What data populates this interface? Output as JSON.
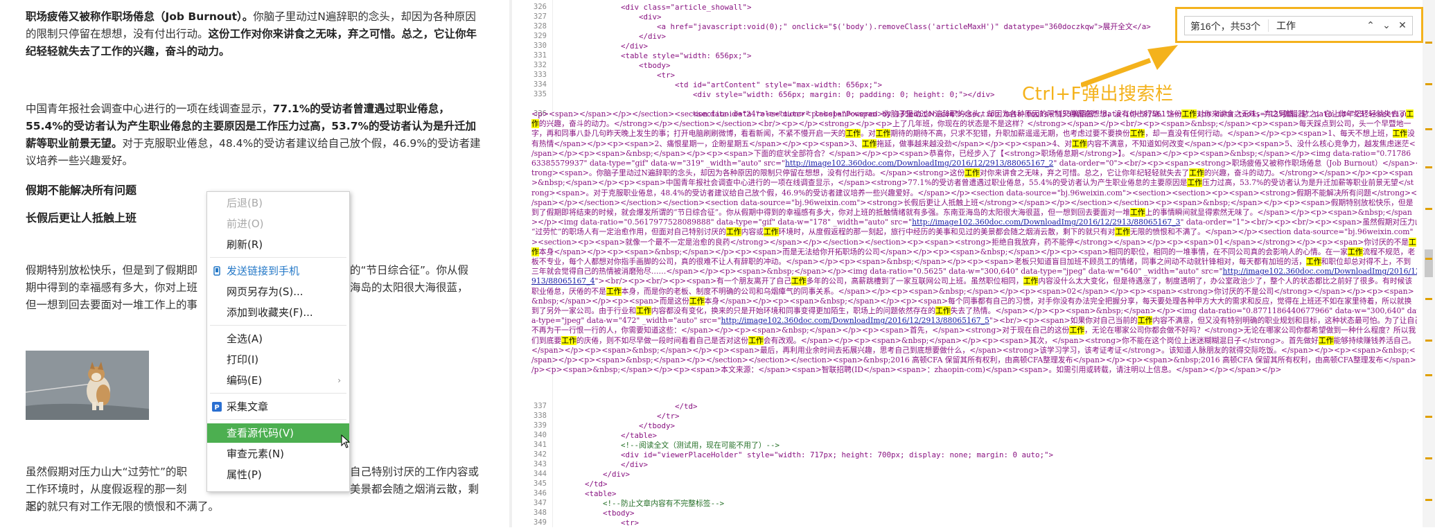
{
  "article": {
    "p1_a": "职场疲倦又被称作职场倦怠（Job Burnout）。",
    "p1_b": "你脑子里动过N遍辞职的念头，却因为各种原因的限制只停留在想想，没有付出行动。",
    "p1_c": "这份工作对你来讲食之无味，弃之可惜。总之，它让你年纪轻轻就失去了工作的兴趣，奋斗的动力。",
    "p2_a": "中国青年报社会调查中心进行的一项在线调查显示，",
    "p2_b": "77.1%的受访者曾遭遇过职业倦怠，55.4%的受访者认为产生职业倦怠的主要原因是工作压力过高，53.7%的受访者认为是升迁加薪等职业前景无望。",
    "p2_c": "对于克服职业倦怠，48.4%的受访者建议给自己放个假，46.9%的受访者建议培养一些兴趣爱好。",
    "heading1": "假期不能解决所有问题",
    "heading2": "长假后更让人抵触上班",
    "p3_line1_a": "假期特别放松快乐，但是到了假期即",
    "p3_line1_b": "的“节日综合征”。你从假",
    "p3_line2_a": "期中得到的幸福感有多大，你对上班",
    "p3_line2_b": "海岛的太阳很大海很蓝，",
    "p3_line3_a": "但一想到回去要面对一堆工作上的事",
    "p4_line1_a": "虽然假期对压力山大“过劳忙”的职",
    "p4_line1_b": "自己特别讨厌的工作内容或",
    "p4_line2_a": "工作环境时，从度假返程的那一刻起，",
    "p4_line2_b": "美景都会随之烟消云散，剩",
    "p4_line3": "下的就只有对工作无限的愤恨和不满了。"
  },
  "context_menu": {
    "back": "后退(B)",
    "forward": "前进(O)",
    "refresh": "刷新(R)",
    "send_to_phone": "发送链接到手机",
    "save_as": "网页另存为(S)...",
    "add_favorite": "添加到收藏夹(F)...",
    "select_all": "全选(A)",
    "print": "打印(I)",
    "encoding": "编码(E)",
    "collect_article": "采集文章",
    "view_source": "查看源代码(V)",
    "inspect": "审查元素(N)",
    "properties": "属性(P)"
  },
  "find_bar": {
    "match_count": "第16个，共53个",
    "query": "工作"
  },
  "annotation": "Ctrl+F弹出搜索栏",
  "source": {
    "line_numbers_top": [
      "326",
      "327",
      "328",
      "329",
      "330",
      "331",
      "332",
      "333",
      "334",
      "335",
      "336"
    ],
    "line_numbers_bottom": [
      "337",
      "338",
      "339",
      "340",
      "341",
      "342",
      "343",
      "344",
      "345",
      "346",
      "347",
      "348",
      "349"
    ],
    "l326": "<div class=\"article_showall\">",
    "l327": "<div>",
    "l328": "<a href=\"javascript:void(0);\" onclick=\"$('body').removeClass('articleMaxH')\" datatype=\"360doczkqw\">展开全文</a>",
    "l329": "</div>",
    "l330": "</div>",
    "l331": "<table style=\"width: 656px;\">",
    "l332": "<tbody>",
    "l333": "<tr>",
    "l334": "<td id=\"artContent\" style=\"max-width: 656px;\">",
    "l335": "<div style=\"width: 656px; margin: 0; padding: 0; height: 0;\"></div>",
    "l336": "<section data-role=\"outer\" label=\"Powered by 135editor.com\"><section data-tools=\"135编辑器\" data-id=\"87561\"><section data-tools=\"135编辑器\" data-id=\"23\"><section",
    "l337": "</td>",
    "l338": "</tr>",
    "l339": "</tbody>",
    "l340": "</table>",
    "l341": "<!--阅读全文（测试用，现在可能不用了）-->",
    "l342": "<div id=\"viewerPlaceHolder\" style=\"width: 717px; height: 700px; display: none; margin: 0 auto;\">",
    "l343": "</div>",
    "l344": "</div>",
    "l345": "</td>",
    "l346": "<table>",
    "l347": "<!--防止文章内容有不完整标签-->",
    "l348": "<tbody>",
    "l349": "<tr>",
    "blob": [
      "<p><span></span></p></section><section data-id=\"24\"><section><p><span><span>你脑子里动过N遍辞职的念头，却因为各种原因的限制只停留在想想，没有付出行动。这份",
      "工作",
      "对你来讲食之无味，弃之可惜。总之，它让你年纪轻轻就失去了",
      "工作",
      "的兴趣，奋斗的动力。</strong></p></section></section><br/><p></p><strong></p><p>上了几年班，你现在的状态是不是这样？</strong></span></p><br/><p><span>&nbsp;</span><p><span>每天踩点到公司，头一个早暨地一字，再和同事八卦几句昨天晚上发生的事；打开电脑刷刷微博，看看新闻，不紧不慢开启一天的",
      "工作",
      "。对",
      "工作",
      "期待的期待不高，只求不犯错，升职加薪遥遥无期，也考虑过要不要换份",
      "工作",
      "，却一直没有任何行动。</span></p><p><span>1、每天不想上班，",
      "工作",
      "没有热情</span></p><p><span>2、痛恨星期一，企盼星期五</span></p><p><span>3、",
      "工作",
      "拖延，做事越来越没劲</span></p><p><span>4、对",
      "工作",
      "内容不满意，不知道如何改变</span></p><p><span>5、没什么核心竞争力，越发焦虑迷茫</span></p><p><span>&nbsp;</span></p><p><span>下面的症状全部符合？</span></p><p><span>恭喜你，已经步入了【<strong>职场倦怠期</strong>】。</span></p><p><span>&nbsp;</span></p><img data-ratio=\"0.7178663385579937\" data-type=\"gif\" data-w=\"319\" _width=\"auto\" src=\"",
      "http://image102.360doc.com/DownloadImg/2016/12/2913/88065167_2",
      "\" data-order=\"0\"><br/><p><span><strong>职场疲倦又被称作职场倦怠（Job Burnout）</span></strong><span>。你脑子里动过N遍辞职的念头，却因为各种原因的限制只停留在想想，没有付出行动。</span><strong>这份",
      "工作",
      "对你来讲食之无味，弃之可惜。总之，它让你年纪轻轻就失去了",
      "工作",
      "的兴趣，奋斗的动力。</strong></span></p><p><span>&nbsp;</span></p><p><span>中国青年报社会调查中心进行的一项在线调查显示，</span><strong>77.1%的受访者曾遭遇过职业倦怠，55.4%的受访者认为产生职业倦怠的主要原因是",
      "工作",
      "压力过高，53.7%的受访者认为是升迁加薪等职业前景无望</strong><span>。对于克服职业倦怠，48.4%的受访者建议给自己放个假，46.9%的受访者建议培养一些兴趣爱好。</span></p><section data-source=\"bj.96weixin.com\"><section><section><p><span><strong>假期不能解决所有问题</strong></span></p></section></section></section><section data-source=\"bj.96weixin.com\"><strong>长假后更让人抵触上班</strong></span></p></section></section><p><span>&nbsp;</span></p><p><span>假期特别放松快乐，但是到了假期即将结束的时候，就会爆发所谓的“节日综合征”。你从假期中得到的幸福感有多大，你对上班的抵触情绪就有多强。东南亚海岛的太阳很大海很蓝，但一想到回去要面对一堆",
      "工作",
      "上的事情瞬间就显得索然无味了。</span></p><p><span>&nbsp;</span></p><img data-ratio=\"0.5617977528089888\" data-type=\"gif\" data-w=\"178\" _width=\"auto\" src=\"",
      "http://image102.360doc.com/DownloadImg/2016/12/2913/88065167_3",
      "\" data-order=\"1\"><br/><p><br/><p><span>虽然假期对压力山大“过劳忙”的职场人有一定治愈作用，但面对自己特别讨厌的",
      "工作",
      "内容或",
      "工作",
      "环境时，从度假返程的那一刻起，旅行中经历的美事和见过的美景都会随之烟消云散，剩下的就只有对",
      "工作",
      "无限的愤恨和不满了。</span></p><section data-source=\"bj.96weixin.com\"><section><p><span>就像一个最不一定是治愈的良药</strong></span></p></section></section><p><span><strong>拒绝自我放弃，药不能停</strong></span></p><p><span>01</span></strong></p><p><span>你讨厌的不是",
      "工作",
      "本身</span></p><p><span>&nbsp;</span></p><p><span>而是无法给你开拓职场的公司</span></p><p><span>&nbsp;</span></p><p><span>相同的职位，相同的一堆事情，在不同公司真的会影响人的心情。在一家",
      "工作",
      "流程不规范，老板不专业，每个人都想对你指手画脚的公司，真的很难不让人有辞职的冲动。</span></p><p><span>&nbsp;</span></p><p><span>老板只知道盲目加班不顾员工的情绪，同事之间动不动就针锋相对，每天都有加班的活，",
      "工作",
      "和职位却总对得不上，不到三年就会觉得自己的热情被消磨殆尽……</span></p><p><span>&nbsp;</span></p><img data-ratio=\"0.5625\" data-w=\"300,640\" data-type=\"jpeg\" data-w=\"640\" _width=\"auto\" src=\"",
      "http://image102.360doc.com/DownloadImg/2016/12/2913/88065167_4",
      "\"><br/><p><br/><p><span>有一个朋友离开了自己",
      "工作",
      "多年的公司，高薪跳槽到了一家互联网公司上班。虽然职位相同，",
      "工作",
      "内容没什么太大变化，但是待遇涨了，制度透明了，办公室政治少了，整个人的状态都比之前好了很多。有时候该职业倦怠，厌倦的不是",
      "工作",
      "本身，而是你的老板、制度不明确的公司和乌烟瘴气的同事关系。</span></p><p><span>&nbsp;</span></p><p><span>02</span></p><p><span><strong>你讨厌的不是公司</strong></span></p><p><span>&nbsp;</span></p><p><span>而是这份",
      "工作",
      "本身</span></p><p><span>&nbsp;</span></p><p><span>每个同事都有自己的习惯，对手你没有办法完全把握分享，每天要处理各种甲方大大的需求和反应，觉得在上班还不如在家里待着，所以就换到了另外一家公司。由于行业和",
      "工作",
      "内容都没有变化，换来的只是开始环境和同事变得更加陌生，职场上的问题依然存在的",
      "工作",
      "失去了热情。</span></p><p><span>&nbsp;</span></p><img data-ratio=\"0.8771186440677966\" data-w=\"300,640\" data-type=\"jpeg\" data-w=\"472\" _width=\"auto\" src=\"",
      "http://image102.360doc.com/DownloadImg/2016/12/2913/88065167_5",
      "\"><br/><p><span>如果你对自己当前的",
      "工作",
      "内容不满意，但又没有特别明确的职业规划和目标，这种状态最可怕。为了让自己不再为干一行恨一行的人，你需要知道这些：</span></p><p><span>&nbsp;</span></p><p><span>首先，</span><strong>对于现在自己的这份",
      "工作",
      "，无论在哪家公司你都会做不好吗？</strong>无论在哪家公司你都希望做到一种什么程度？所以我们到底要",
      "工作",
      "的庆倦，则不如尽早做一段时间看看自己是否对这份",
      "工作",
      "会有改观。</span></p><p><span>&nbsp;</span></p><p><span>其次，</span><strong>你不能在这个岗位上迷迷糊糊混日子</strong>。首先做好",
      "工作",
      "能够持续赚钱养活自己。</span></p><p><span>&nbsp;</span></p><p><span>最后，再利用业余时间去拓展兴趣，思考自己到底想要做什么，</span><strong>该学习学习，该考证考证</strong>。该知道人脉朋友的就得交际吃饭。</span></p><p><span>&nbsp;</span></p><p><span>&nbsp;</span></p></section></section></section><span>&nbsp;2016 高顿CFA 保留其所有权利，由高顿CFA整理发布</span></p><p><span>&nbsp;2016 高顿CFA 保留其所有权利，由高顿CFA整理发布</span></p><p><span>&nbsp;</span></p><p><span>本文来源：</span><span>智联招聘(ID</span><span>：zhaopin-com)</span><span>。如需引用或转载，请注明以上信息。</span></p></span></p>"
    ]
  }
}
